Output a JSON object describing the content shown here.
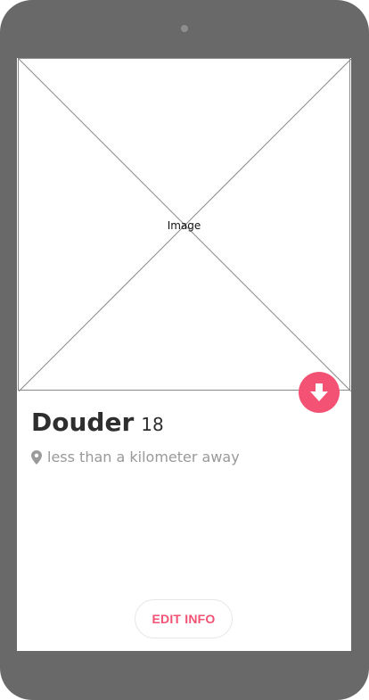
{
  "profile": {
    "image_placeholder": "Image",
    "name": "Douder",
    "age": "18",
    "location": "less than a kilometer away"
  },
  "actions": {
    "edit_label": "EDIT INFO",
    "download_icon": "arrow-down-circle-icon",
    "location_icon": "map-pin-icon"
  },
  "colors": {
    "accent": "#f35274",
    "device_frame": "#696969",
    "secondary_text": "#999999",
    "primary_text": "#2e2e2e"
  }
}
